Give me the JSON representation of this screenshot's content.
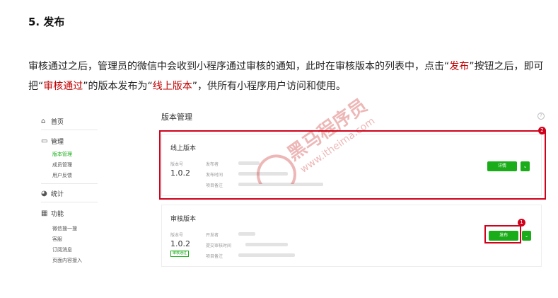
{
  "heading": "5. 发布",
  "paragraph": {
    "part1": "审核通过之后，管理员的微信中会收到小程序通过审核的通知，此时在审核版本的列表中，点击“",
    "hl1": "发布",
    "part2": "”按钮之后，即可把“",
    "hl2": "审核通过",
    "part3": "”的版本发布为“",
    "hl3": "线上版本",
    "part4": "”，供所有小程序用户访问和使用。"
  },
  "sidebar": {
    "home": "首页",
    "manage": "管理",
    "manage_items": [
      "版本管理",
      "成员管理",
      "用户反馈"
    ],
    "stats": "统计",
    "features": "功能",
    "feature_items": [
      "微信搜一搜",
      "客服",
      "订阅消息",
      "页面内容接入"
    ]
  },
  "page_title": "版本管理",
  "online_card": {
    "title": "线上版本",
    "version_label": "版本号",
    "version": "1.0.2",
    "fields": [
      "发布者",
      "发布时间",
      "项目备注"
    ],
    "button": "详情"
  },
  "review_card": {
    "title": "审核版本",
    "version_label": "版本号",
    "version": "1.0.2",
    "tag": "审核通过",
    "fields": [
      "开发者",
      "提交审核时间",
      "项目备注"
    ],
    "button": "发布"
  },
  "markers": [
    "1",
    "2"
  ],
  "watermark": {
    "cn": "黑马程序员",
    "url": "www.itheima.com"
  },
  "colors": {
    "accent_green": "#1aad19",
    "highlight_red": "#c00000",
    "marker_red": "#d0021b"
  }
}
